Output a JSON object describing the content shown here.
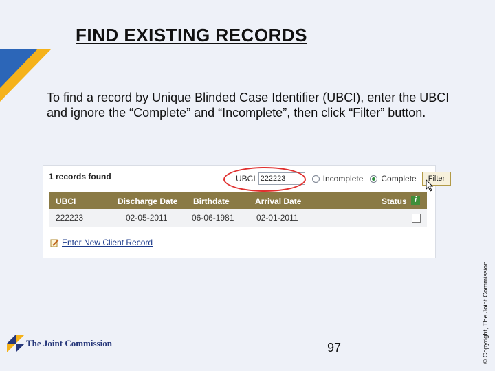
{
  "slide": {
    "title": "FIND EXISTING RECORDS",
    "instruction": "To find a record by Unique Blinded Case Identifier (UBCI), enter the UBCI and ignore the “Complete” and “Incomplete”, then click “Filter” button.",
    "copyright": "© Copyright, The Joint Commission",
    "page_number": "97",
    "logo_text": "The Joint Commission"
  },
  "screenshot": {
    "records_found": "1 records found",
    "filter": {
      "ubci_label": "UBCI",
      "ubci_value": "222223",
      "option_incomplete": "Incomplete",
      "option_complete": "Complete",
      "selected_option": "Complete",
      "filter_button": "Filter"
    },
    "table": {
      "columns": [
        "UBCI",
        "Discharge Date",
        "Birthdate",
        "Arrival Date",
        "Status"
      ],
      "rows": [
        {
          "ubci": "222223",
          "discharge_date": "02-05-2011",
          "birthdate": "06-06-1981",
          "arrival_date": "02-01-2011",
          "status_checked": false
        }
      ]
    },
    "enter_new_link": "Enter New Client Record"
  },
  "colors": {
    "background": "#eef1f8",
    "table_header": "#8a7a45",
    "highlight": "#e0302f",
    "link": "#1b3a8a",
    "brand_navy": "#26377a",
    "brand_yellow": "#f5b21a"
  },
  "icons": [
    "pencil-note-icon",
    "info-icon",
    "mouse-cursor-icon",
    "joint-commission-logo-icon"
  ]
}
